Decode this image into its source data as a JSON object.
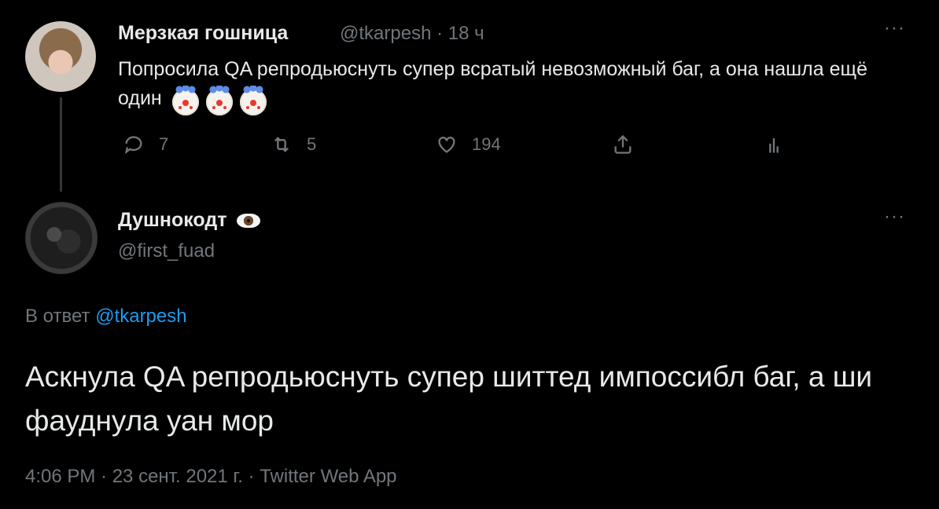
{
  "parent_tweet": {
    "author_name": "Мерзкая гошница",
    "meta": "@tkarpesh · 18 ч",
    "more": "···",
    "text": "Попросила QA репродьюснуть супер всратый невозможный баг, а она нашла ещё один",
    "emoji_icons": [
      "clown-face-icon",
      "clown-face-icon",
      "clown-face-icon"
    ],
    "actions": {
      "reply_count": "7",
      "retweet_count": "5",
      "like_count": "194"
    }
  },
  "reply_tweet": {
    "author_name": "Душнокодт",
    "handle": "@first_fuad",
    "more": "···",
    "replying_prefix": "В ответ",
    "replying_mention": "@tkarpesh",
    "text": "Аскнула QA репродьюснуть супер шиттед импоссибл баг, а ши фауднула уан мор",
    "footer": "4:06 PM · 23 сент. 2021 г. · Twitter Web App"
  },
  "colors": {
    "background": "#000000",
    "text_primary": "#e7e9ea",
    "text_secondary": "#71767b",
    "link": "#1d9bf0"
  }
}
